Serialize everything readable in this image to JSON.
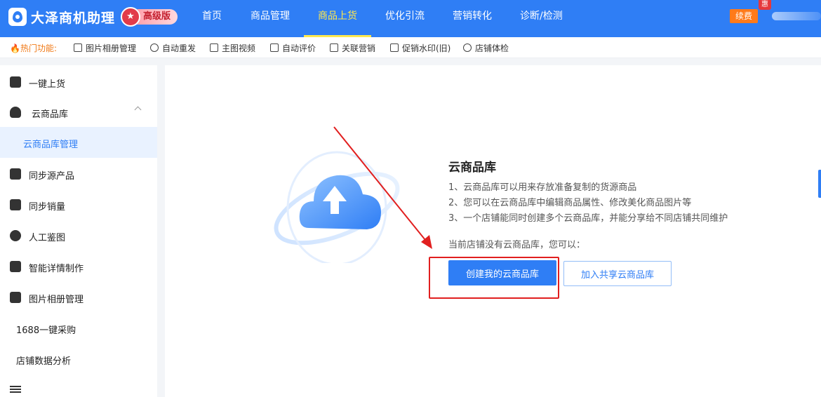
{
  "app": {
    "name": "大泽商机助理",
    "edition": "高级版"
  },
  "nav": [
    "首页",
    "商品管理",
    "商品上货",
    "优化引流",
    "营销转化",
    "诊断/检测"
  ],
  "nav_active_index": 2,
  "header": {
    "renew_label": "续费",
    "promo_badge": "惠"
  },
  "hot": {
    "label": "热门功能:",
    "items": [
      "图片相册管理",
      "自动重发",
      "主图视频",
      "自动评价",
      "关联营销",
      "促销水印(旧)",
      "店铺体检"
    ]
  },
  "sidebar": {
    "items": [
      "一键上货",
      "云商品库",
      "云商品库管理",
      "同步源产品",
      "同步销量",
      "人工鉴图",
      "智能详情制作",
      "图片相册管理",
      "1688一键采购",
      "店铺数据分析"
    ],
    "active": "云商品库管理"
  },
  "main": {
    "title": "云商品库",
    "desc1": "1、云商品库可以用来存放准备复制的货源商品",
    "desc2": "2、您可以在云商品库中编辑商品属性、修改美化商品图片等",
    "desc3": "3、一个店铺能同时创建多个云商品库，并能分享给不同店铺共同维护",
    "prompt": "当前店铺没有云商品库，您可以：",
    "create_button": "创建我的云商品库",
    "join_button": "加入共享云商品库"
  },
  "colors": {
    "primary": "#2f7ef5",
    "highlight": "#e11f1f",
    "hot": "#f07a18",
    "renew": "#ff7a1a"
  }
}
